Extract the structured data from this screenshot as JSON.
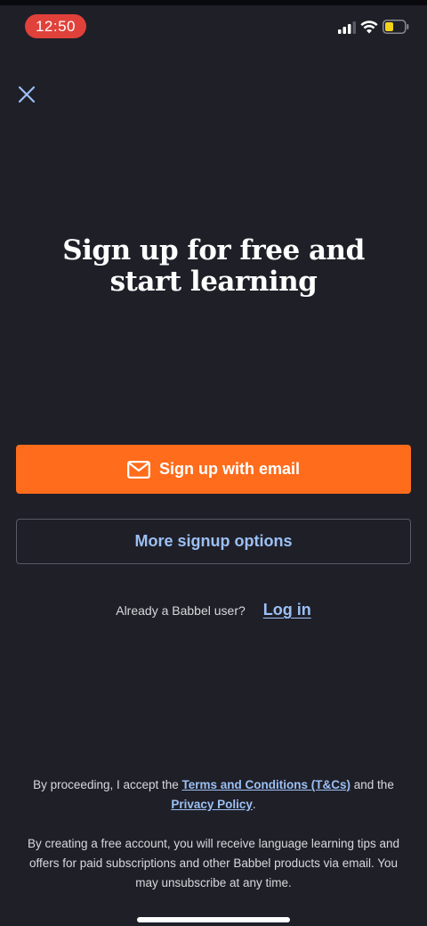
{
  "status_bar": {
    "time": "12:50",
    "icons": [
      "cellular-signal-icon",
      "wifi-icon",
      "battery-low-icon"
    ],
    "battery_color": "#f3d21a"
  },
  "close_icon": "close-icon",
  "heading": {
    "line1": "Sign up for free and",
    "line2": "start learning"
  },
  "primary_button": {
    "icon": "mail-icon",
    "label": "Sign up with email",
    "color": "#fe6c1c"
  },
  "secondary_button": {
    "label": "More signup options"
  },
  "login": {
    "prompt": "Already a Babbel user?",
    "link": "Log in"
  },
  "legal": {
    "consent_prefix": "By proceeding, I accept the ",
    "terms_link": "Terms and Conditions (T&Cs)",
    "consent_middle": " and the ",
    "privacy_link": "Privacy Policy",
    "consent_suffix": ".",
    "marketing_notice": "By creating a free account, you will receive language learning tips and offers for paid subscriptions and other Babbel products via email. You may unsubscribe at any time."
  },
  "colors": {
    "background": "#1f1f28",
    "accent_link": "#9cc0f4"
  }
}
